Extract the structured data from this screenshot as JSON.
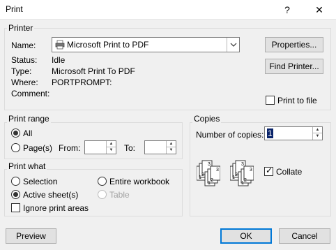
{
  "window": {
    "title": "Print",
    "help_glyph": "?",
    "close_glyph": "✕"
  },
  "printer": {
    "group_label": "Printer",
    "name_label": "Name:",
    "name_value": "Microsoft Print to PDF",
    "printer_icon": "printer-icon",
    "status_label": "Status:",
    "status_value": "Idle",
    "type_label": "Type:",
    "type_value": "Microsoft Print To PDF",
    "where_label": "Where:",
    "where_value": "PORTPROMPT:",
    "comment_label": "Comment:",
    "comment_value": "",
    "properties_button": "Properties...",
    "find_printer_button": "Find Printer...",
    "print_to_file_label": "Print to file",
    "print_to_file_checked": false
  },
  "print_range": {
    "group_label": "Print range",
    "all_label": "All",
    "pages_label": "Page(s)",
    "from_label": "From:",
    "to_label": "To:",
    "from_value": "",
    "to_value": "",
    "selected": "all"
  },
  "print_what": {
    "group_label": "Print what",
    "selection_label": "Selection",
    "entire_workbook_label": "Entire workbook",
    "active_sheets_label": "Active sheet(s)",
    "table_label": "Table",
    "ignore_print_areas_label": "Ignore print areas",
    "selected": "active_sheets",
    "table_disabled": true,
    "ignore_print_areas_checked": false
  },
  "copies": {
    "group_label": "Copies",
    "number_label": "Number of copies:",
    "number_value": "1",
    "collate_label": "Collate",
    "collate_checked": true,
    "uncollated_labels": [
      "1",
      "1",
      "2",
      "2",
      "3",
      "3"
    ],
    "collated_labels": [
      "1",
      "2",
      "3",
      "1",
      "2",
      "3"
    ]
  },
  "footer": {
    "preview_button": "Preview",
    "ok_button": "OK",
    "cancel_button": "Cancel"
  }
}
